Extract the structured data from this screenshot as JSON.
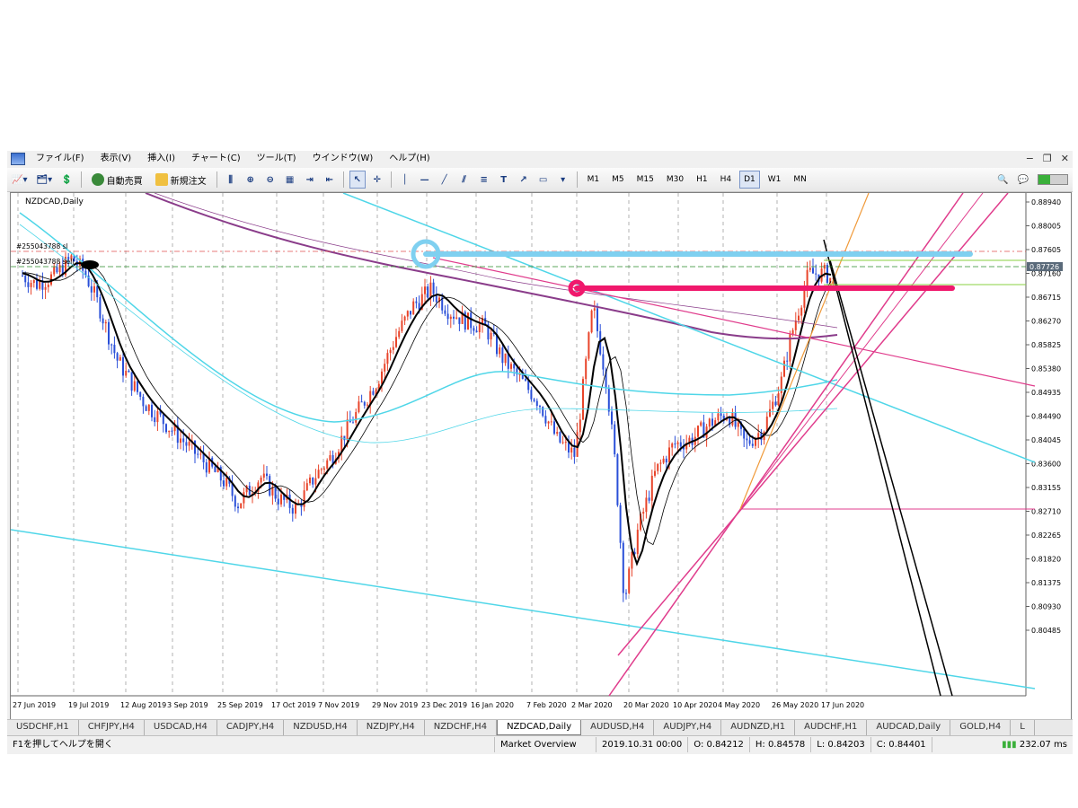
{
  "menu": [
    "ファイル(F)",
    "表示(V)",
    "挿入(I)",
    "チャート(C)",
    "ツール(T)",
    "ウインドウ(W)",
    "ヘルプ(H)"
  ],
  "toolbar": {
    "auto_trade": "自動売買",
    "new_order": "新規注文",
    "timeframes": [
      "M1",
      "M5",
      "M15",
      "M30",
      "H1",
      "H4",
      "D1",
      "W1",
      "MN"
    ],
    "active_timeframe": "D1"
  },
  "chart": {
    "title": "NZDCAD,Daily",
    "order_label_1": "#255043788 sl",
    "order_label_2": "#255043788 sell",
    "current_price": "0.87726",
    "price_ticks": [
      "0.88940",
      "0.88005",
      "0.87605",
      "0.87160",
      "0.86715",
      "0.86270",
      "0.85825",
      "0.85380",
      "0.84935",
      "0.84490",
      "0.84045",
      "0.83600",
      "0.83155",
      "0.82710",
      "0.82265",
      "0.81820",
      "0.81375",
      "0.80930",
      "0.80485"
    ],
    "date_ticks": [
      "27 Jun 2019",
      "19 Jul 2019",
      "12 Aug 2019",
      "3 Sep 2019",
      "25 Sep 2019",
      "17 Oct 2019",
      "7 Nov 2019",
      "29 Nov 2019",
      "23 Dec 2019",
      "16 Jan 2020",
      "7 Feb 2020",
      "2 Mar 2020",
      "20 Mar 2020",
      "10 Apr 2020",
      "4 May 2020",
      "26 May 2020",
      "17 Jun 2020"
    ],
    "colors": {
      "bull": "#e8442a",
      "bear": "#2a4fd8",
      "cyan": "#4fd6e8",
      "magenta": "#e03c8c",
      "purple": "#8a3c8a",
      "hl_blue": "#7fd0f0",
      "hl_pink": "#f0186c",
      "orange": "#f09a3a"
    }
  },
  "tabs": [
    "USDCHF,H1",
    "CHFJPY,H4",
    "USDCAD,H4",
    "CADJPY,H4",
    "NZDUSD,H4",
    "NZDJPY,H4",
    "NZDCHF,H4",
    "NZDCAD,Daily",
    "AUDUSD,H4",
    "AUDJPY,H4",
    "AUDNZD,H1",
    "AUDCHF,H1",
    "AUDCAD,Daily",
    "GOLD,H4",
    "L"
  ],
  "active_tab": "NZDCAD,Daily",
  "status": {
    "help": "F1を押してヘルプを開く",
    "profile": "Market Overview",
    "datetime": "2019.10.31 00:00",
    "open": "O: 0.84212",
    "high": "H: 0.84578",
    "low": "L: 0.84203",
    "close": "C: 0.84401",
    "ping": "232.07 ms"
  }
}
